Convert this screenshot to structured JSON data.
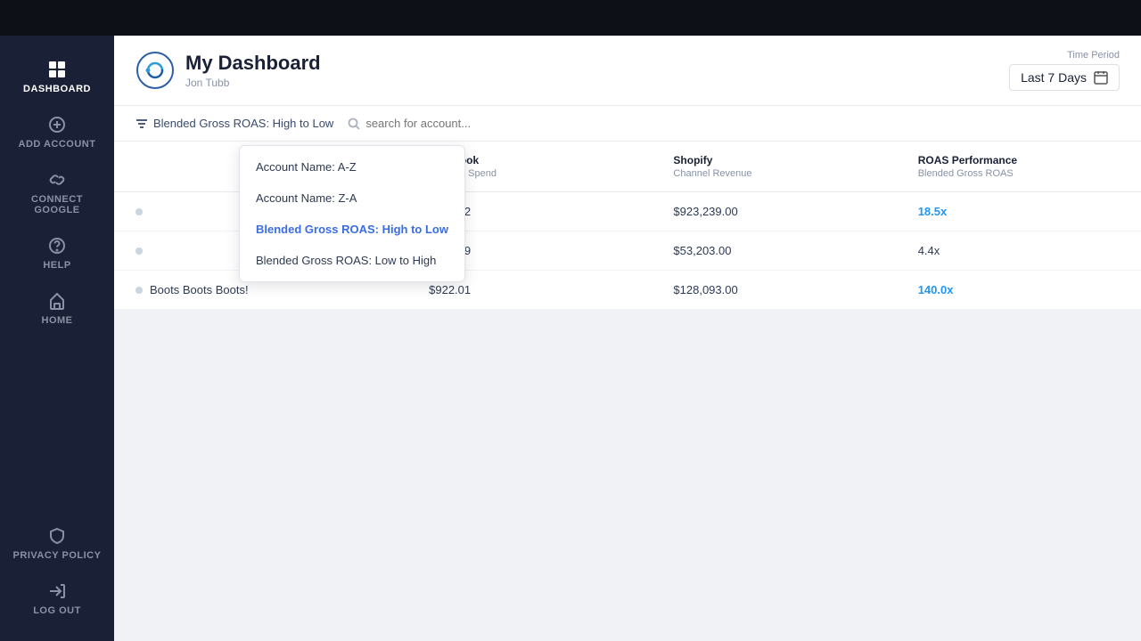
{
  "topBar": {},
  "sidebar": {
    "items": [
      {
        "id": "dashboard",
        "label": "DASHBOARD",
        "icon": "grid",
        "active": true
      },
      {
        "id": "add-account",
        "label": "ADD ACCOUNT",
        "icon": "plus-circle"
      },
      {
        "id": "connect-google",
        "label": "CONNECT GOOGLE",
        "icon": "link"
      },
      {
        "id": "help",
        "label": "HELP",
        "icon": "question-circle"
      },
      {
        "id": "home",
        "label": "HOME",
        "icon": "home"
      }
    ],
    "bottomItems": [
      {
        "id": "privacy-policy",
        "label": "PRIVACY POLICY",
        "icon": "shield"
      },
      {
        "id": "log-out",
        "label": "LOG OUT",
        "icon": "log-out"
      }
    ]
  },
  "header": {
    "title": "My Dashboard",
    "subtitle": "Jon Tubb",
    "timePeriod": {
      "label": "Time Period",
      "value": "Last 7 Days",
      "calendarIcon": "calendar"
    }
  },
  "filterBar": {
    "sortLabel": "Blended Gross ROAS: High to Low",
    "searchPlaceholder": "search for account..."
  },
  "dropdown": {
    "items": [
      {
        "id": "name-az",
        "label": "Account Name: A-Z",
        "selected": false
      },
      {
        "id": "name-za",
        "label": "Account Name: Z-A",
        "selected": false
      },
      {
        "id": "roas-high-low",
        "label": "Blended Gross ROAS: High to Low",
        "selected": true
      },
      {
        "id": "roas-low-high",
        "label": "Blended Gross ROAS: Low to High",
        "selected": false
      }
    ]
  },
  "table": {
    "columns": [
      {
        "id": "account",
        "label": "",
        "sublabel": ""
      },
      {
        "id": "facebook",
        "label": "Facebook",
        "sublabel": "Channel Spend"
      },
      {
        "id": "shopify",
        "label": "Shopify",
        "sublabel": "Channel Revenue"
      },
      {
        "id": "roas",
        "label": "ROAS Performance",
        "sublabel": "Blended Gross ROAS"
      }
    ],
    "rows": [
      {
        "name": "",
        "facebook": "$50,102",
        "shopify": "$923,239.00",
        "roas": "18.5x",
        "roasHighlight": true
      },
      {
        "name": "",
        "facebook": "$12,009",
        "shopify": "$53,203.00",
        "roas": "4.4x",
        "roasHighlight": false
      },
      {
        "name": "Boots Boots Boots!",
        "facebook": "$922.01",
        "shopify": "$128,093.00",
        "roas": "140.0x",
        "roasHighlight": true
      }
    ]
  }
}
